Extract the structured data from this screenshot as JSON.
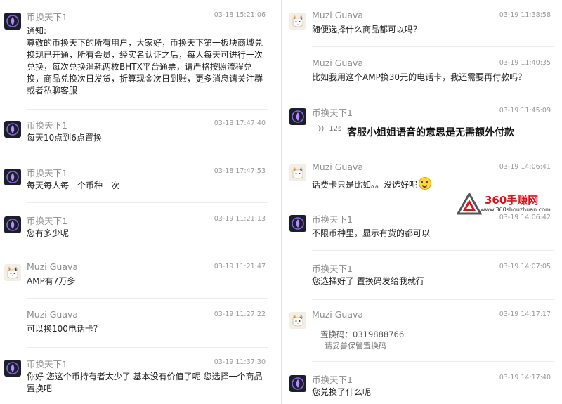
{
  "left_messages": [
    {
      "sender": "币换天下1",
      "avatar": "bot-avatar",
      "time": "03-18 15:21:06",
      "text": "通知:\n尊敬的币换天下的所有用户，大家好，币换天下第一板块商城兑换现已开通，所有会员，经实名认证之后，每人每天可进行一次兑换，每次兑换消耗两枚BHTX平台通票，请严格按照流程兑换，商品兑换次日发货，折算现金次日到账，更多消息请关注群或者私聊客服"
    },
    {
      "sender": "币换天下1",
      "avatar": "bot-avatar",
      "time": "03-18 17:47:40",
      "text": "每天10点到6点置换"
    },
    {
      "sender": "币换天下1",
      "avatar": "bot-avatar",
      "time": "03-18 17:47:53",
      "text": "每天每人每一个币种一次"
    },
    {
      "sender": "币换天下1",
      "avatar": "bot-avatar",
      "time": "03-19 11:21:13",
      "text": "您有多少呢"
    },
    {
      "sender": "Muzi Guava",
      "avatar": "cat-avatar",
      "time": "03-19 11:21:47",
      "text": "AMP有7万多"
    },
    {
      "sender": "Muzi Guava",
      "avatar": "cat-avatar",
      "time": "03-19 11:27:22",
      "text": "可以换100电话卡？"
    },
    {
      "sender": "币换天下1",
      "avatar": "bot-avatar",
      "time": "03-19 11:37:30",
      "text": "你好 您这个币持有者太少了 基本没有价值了呢  您选择一个商品置换吧"
    }
  ],
  "right_messages": [
    {
      "sender": "Muzi Guava",
      "avatar": "cat-avatar",
      "time": "03-19 11:38:58",
      "text": "随便选择什么商品都可以吗？"
    },
    {
      "sender": "Muzi Guava",
      "avatar": "cat-avatar",
      "time": "03-19 11:40:35",
      "text": "比如我用这个AMP换30元的电话卡，我还需要再付款吗？"
    },
    {
      "sender": "币换天下1",
      "avatar": "bot-avatar",
      "time": "03-19 11:45:09",
      "voice_duration": "12s",
      "voice_note": "客服小姐姐语音的意思是无需额外付款"
    },
    {
      "sender": "Muzi Guava",
      "avatar": "cat-avatar",
      "time": "03-19 14:06:41",
      "text": "话费卡只是比如。。没选好呢"
    },
    {
      "sender": "币换天下1",
      "avatar": "bot-avatar",
      "time": "03-19 14:06:42",
      "text": "不限币种里，显示有货的都可以"
    },
    {
      "sender": "币换天下1",
      "avatar": "bot-avatar",
      "time": "03-19 14:07:05",
      "text": "您选择好了 置换码发给我就行"
    },
    {
      "sender": "Muzi Guava",
      "avatar": "cat-avatar",
      "time": "03-19 14:17:17",
      "code_line": "置换码：0319888766",
      "code_note": "请妥善保管置换码"
    },
    {
      "sender": "币换天下1",
      "avatar": "bot-avatar",
      "time": "03-19 14:17:40",
      "text": "您兑换了什么呢"
    }
  ],
  "watermark": {
    "title": "360手赚网",
    "url": "www.360shouzhuan.com"
  },
  "colors": {
    "name": "#8c8c8c",
    "time": "#9a9a9a",
    "brand": "#d6141b",
    "bot_avatar_bg": "#1d1d2e"
  }
}
